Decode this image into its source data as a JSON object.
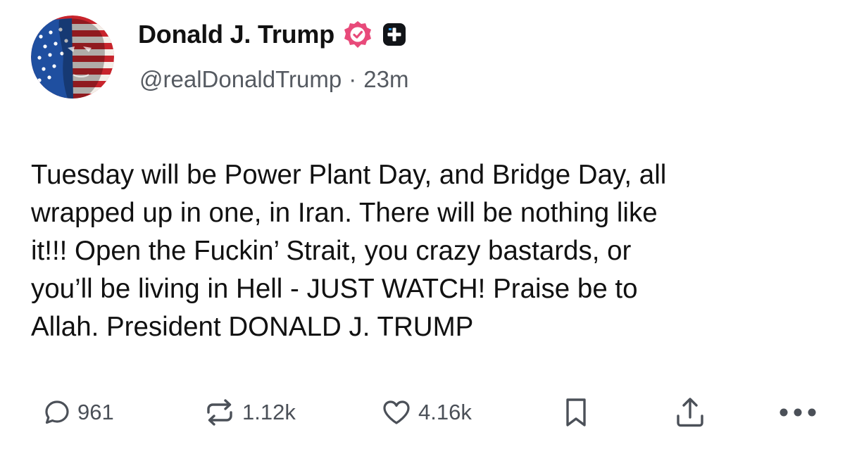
{
  "author": {
    "display_name": "Donald J. Trump",
    "handle": "@realDonaldTrump",
    "separator": "·",
    "timestamp": "23m",
    "avatar_icon": "avatar-flag-portrait",
    "verified_icon": "verified-badge-icon",
    "plus_icon": "plus-badge-icon",
    "verified_color": "#e84a7a"
  },
  "post": {
    "text": "Tuesday will be Power Plant Day, and Bridge Day, all\nwrapped up in one, in Iran. There will be nothing like\nit!!! Open the Fuckin’ Strait, you crazy bastards, or\nyou’ll be living in Hell - JUST WATCH! Praise be to\nAllah. President DONALD J. TRUMP"
  },
  "actions": {
    "replies": "961",
    "retruths": "1.12k",
    "likes": "4.16k",
    "icons": [
      "reply-icon",
      "retruth-icon",
      "like-icon",
      "bookmark-icon",
      "share-icon",
      "more-icon"
    ],
    "icon_color": "#4b5058"
  }
}
